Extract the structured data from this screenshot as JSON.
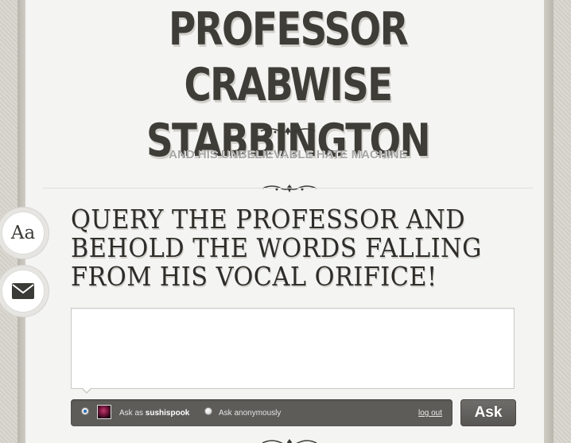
{
  "header": {
    "title_line1": "PROFESSOR CRABWISE",
    "title_line2": "STABBINGTON",
    "subtitle": "AND HIS UNBELIEVABLE HATE MACHINE"
  },
  "ask_section": {
    "heading_line1": "QUERY THE PROFESSOR AND",
    "heading_line2": "BEHOLD THE WORDS FALLING",
    "heading_line3": "FROM HIS VOCAL ORIFICE!",
    "question_value": "",
    "ask_as_prefix": "Ask as",
    "username": "sushispook",
    "anonymous_label": "Ask anonymously",
    "logout_label": "log out",
    "ask_button_label": "Ask",
    "selected_option": "ask-as-user"
  },
  "side_buttons": {
    "font_button_label": "Aa",
    "mail_icon": "envelope-icon"
  },
  "colors": {
    "title": "#3f3d37",
    "subtitle": "#a6a6a4",
    "ask_bar": "#5d5c59",
    "page_bg": "#f4f4f3",
    "body_bg": "#d8d5cd"
  }
}
